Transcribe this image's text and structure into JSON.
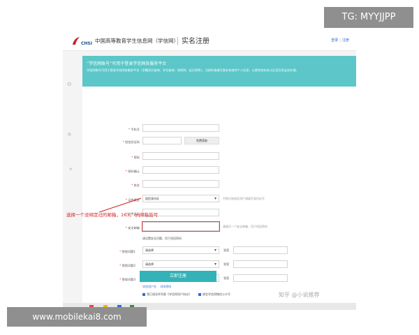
{
  "overlay": {
    "tg_label": "TG: MYYJJPP",
    "site_label": "www.mobilekai8.com"
  },
  "header": {
    "logo_abbr": "CHSI",
    "site_name": "中国高等教育学生信息网（学信网）",
    "page_title": "实名注册",
    "login_link": "登录",
    "register_link": "注册"
  },
  "banner": {
    "title": "“学信网账号”可用于登录学信网各服务平台",
    "description": "学信网账号可用于登录学信网各服务平台（学籍学历查询、学位查询、研招网、征兵网等）。注册时请填写真实有效的个人信息，以便完成实名认证及后续业务办理。"
  },
  "form": {
    "mobile_label": "手机号",
    "sms_label": "短信验证码",
    "sms_button": "免费获取",
    "password_label": "密码",
    "password_confirm_label": "密码确认",
    "name_label": "姓名",
    "id_type_label": "证件类型",
    "id_type_value": "居民身份证",
    "id_type_hint": "中国大陆地区用户请填写身份证号",
    "id_number_label": "证件号码",
    "email_label": "安全邮箱",
    "email_hint": "请填写一个安全邮箱，用于找回密码",
    "security_note": "请设置安全问题，用于找回密码",
    "q1_label": "密保问题1",
    "q2_label": "密保问题2",
    "q3_label": "密保问题3",
    "select_placeholder": "请选择",
    "answer_label": "答案",
    "agree_text": "我已阅读并同意《学信网用户协议》",
    "bind_text": "绑定学信网微信公众号",
    "submit_label": "立即注册",
    "bottom_link_1": "浏览用户名",
    "bottom_link_2": "浏览密码"
  },
  "annotation": "选择一个没绑定过的邮箱，163，qq邮箱皆可",
  "watermark": "知乎 @小说推荐"
}
